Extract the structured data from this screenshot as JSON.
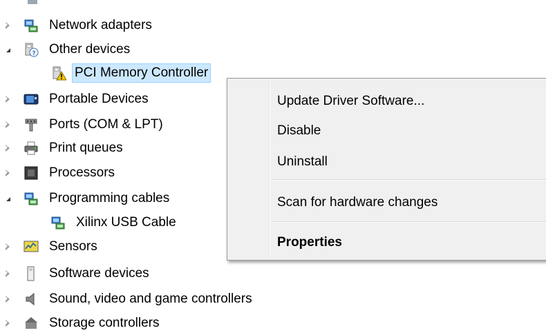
{
  "tree": {
    "items": [
      {
        "label": "Network adapters",
        "state": "collapsed",
        "icon": "network-adapter-icon"
      },
      {
        "label": "Other devices",
        "state": "expanded",
        "icon": "unknown-device-icon"
      },
      {
        "label": "PCI Memory Controller",
        "state": "leaf",
        "icon": "warning-device-icon",
        "selected": true
      },
      {
        "label": "Portable Devices",
        "state": "collapsed",
        "icon": "portable-device-icon"
      },
      {
        "label": "Ports (COM & LPT)",
        "state": "collapsed",
        "icon": "port-icon"
      },
      {
        "label": "Print queues",
        "state": "collapsed",
        "icon": "printer-icon"
      },
      {
        "label": "Processors",
        "state": "collapsed",
        "icon": "processor-icon"
      },
      {
        "label": "Programming cables",
        "state": "expanded",
        "icon": "network-adapter-icon"
      },
      {
        "label": "Xilinx USB Cable",
        "state": "leaf",
        "icon": "network-adapter-icon"
      },
      {
        "label": "Sensors",
        "state": "collapsed",
        "icon": "sensor-icon"
      },
      {
        "label": "Software devices",
        "state": "collapsed",
        "icon": "software-device-icon"
      },
      {
        "label": "Sound, video and game controllers",
        "state": "collapsed",
        "icon": "speaker-icon"
      },
      {
        "label": "Storage controllers",
        "state": "collapsed",
        "icon": "storage-controller-icon"
      }
    ]
  },
  "context_menu": {
    "items": [
      {
        "label": "Update Driver Software..."
      },
      {
        "label": "Disable"
      },
      {
        "label": "Uninstall"
      },
      {
        "label": "Scan for hardware changes"
      },
      {
        "label": "Properties"
      }
    ]
  },
  "colors": {
    "selection_fill": "#cce8ff",
    "selection_border": "#99d1ff",
    "menu_background": "#f0f0f0"
  }
}
